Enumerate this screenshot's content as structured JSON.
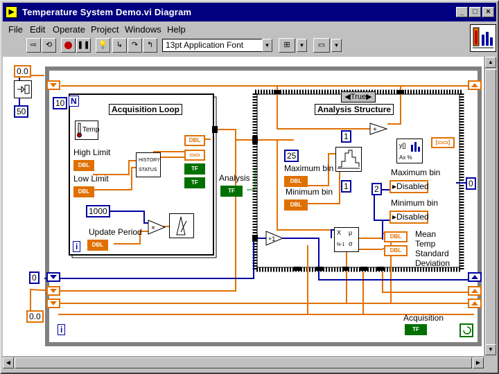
{
  "window": {
    "title": "Temperature System Demo.vi Diagram",
    "controls": [
      "_",
      "□",
      "×"
    ]
  },
  "menu": [
    "File",
    "Edit",
    "Operate",
    "Project",
    "Windows",
    "Help"
  ],
  "toolbar": {
    "font": "13pt Application Font"
  },
  "diagram": {
    "while_loop_count": "N",
    "while_loop_index": "i",
    "outer_loop_index": "i",
    "const_delay": "0.0",
    "const_50": "50",
    "const_10": "10",
    "const_0": "0",
    "const_0_0": "0.0",
    "const_1000": "1000",
    "const_25": "25",
    "const_1a": "1",
    "const_1b": "1",
    "const_2": "2",
    "const_0_right": "0",
    "acq_loop_label": "Acquisition Loop",
    "analysis_structure_label": "Analysis Structure",
    "case_selector": "True",
    "temp_label": "Temp",
    "high_limit_label": "High Limit",
    "low_limit_label": "Low Limit",
    "update_period_label": "Update Period",
    "analysis_label": "Analysis",
    "max_bin_label": "Maximum bin",
    "min_bin_label": "Minimum bin",
    "max_bin_out_label": "Maximum bin",
    "min_bin_out_label": "Minimum bin",
    "disabled_1": "Disabled",
    "disabled_2": "Disabled",
    "mean_label": "Mean",
    "temp_label_2": "Temp",
    "standard_label": "Standard",
    "deviation_label": "Deviation",
    "acquisition_label": "Acquisition",
    "dbl": "DBL",
    "tf": "TF",
    "history_label": "HISTORY",
    "status_label": "STATUS",
    "ax_label": "Ax %"
  },
  "colors": {
    "orange_wire": "#e07000",
    "blue_wire": "#0000a0",
    "green_wire": "#007000",
    "loop_border": "#808080",
    "title_bg": "#000080"
  }
}
